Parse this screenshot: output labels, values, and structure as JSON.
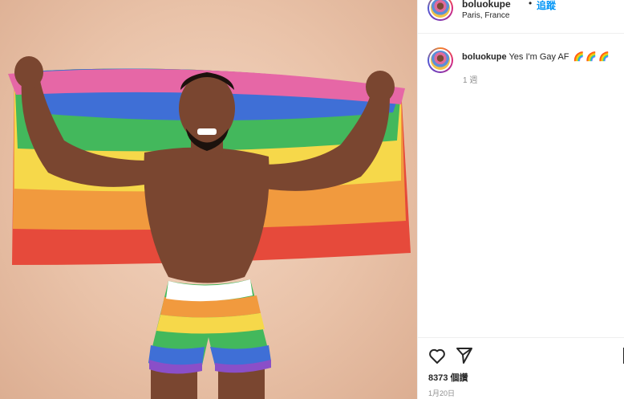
{
  "post": {
    "username": "boluokupe",
    "dot": "•",
    "follow_label": "追蹤",
    "location": "Paris, France",
    "caption": {
      "username": "boluokupe",
      "text": "Yes I'm Gay AF",
      "emojis": [
        "🌈",
        "🌈",
        "🌈"
      ],
      "time": "1 週"
    },
    "likes": "8373 個讚",
    "date": "1月20日"
  },
  "icons": {
    "like": "heart-icon",
    "share": "paper-plane-icon"
  },
  "colors": {
    "follow": "#0095f6",
    "background_photo": "#e9c2a8",
    "flag": [
      "#e64a3b",
      "#f19a3e",
      "#f6d84a",
      "#43b85c",
      "#3f6fd6",
      "#8a4fc8",
      "#e667a6"
    ]
  }
}
